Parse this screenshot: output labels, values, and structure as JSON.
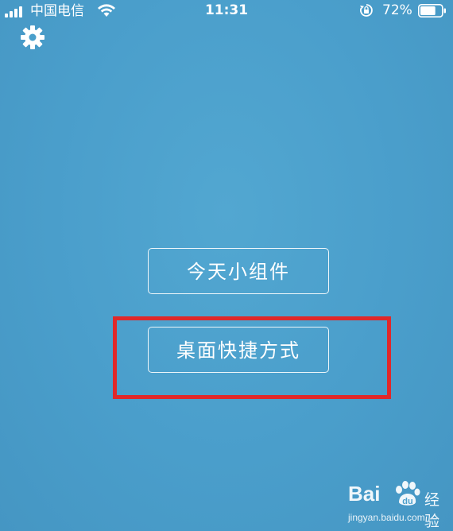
{
  "status_bar": {
    "carrier": "中国电信",
    "time": "11:31",
    "battery_percent": "72%",
    "battery_level": 0.72,
    "icons": [
      "signal-icon",
      "wifi-icon",
      "rotation-lock-icon",
      "battery-icon"
    ]
  },
  "header": {
    "settings_icon": "gear-icon"
  },
  "menu": {
    "buttons": [
      {
        "label": "今天小组件"
      },
      {
        "label": "桌面快捷方式"
      }
    ]
  },
  "annotation": {
    "highlight_color": "#e0282a"
  },
  "watermark": {
    "logo_text": "Bai",
    "logo_text_2": "经验",
    "url": "jingyan.baidu.com"
  },
  "colors": {
    "background": "#4a9fcb",
    "button_border": "#ffffff",
    "text": "#ffffff"
  }
}
